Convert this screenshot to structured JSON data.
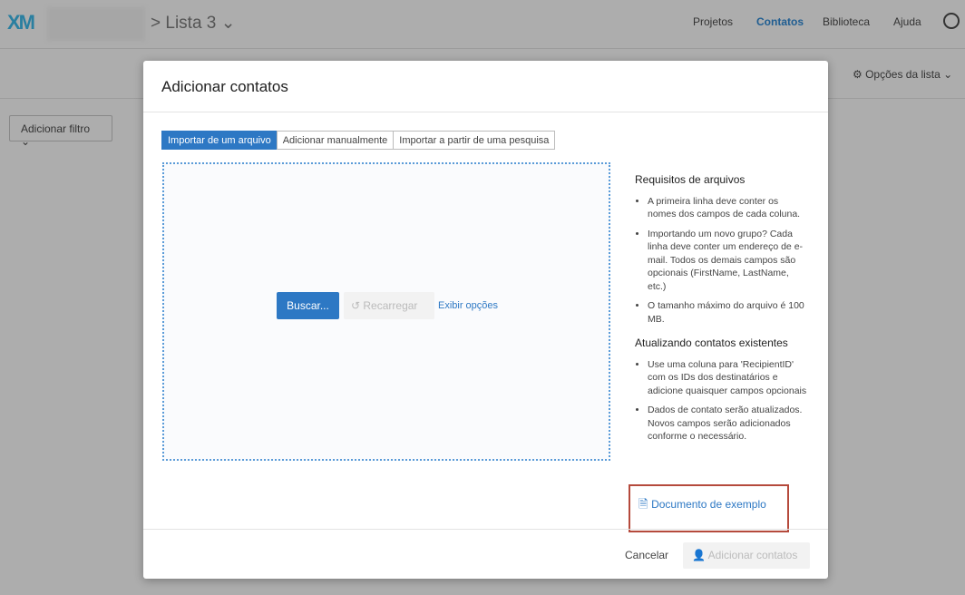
{
  "topbar": {
    "logo": "XM",
    "breadcrumb": "> Lista 3 ⌄",
    "nav": [
      "Projetos",
      "Contatos",
      "Biblioteca",
      "Ajuda"
    ]
  },
  "toolbar": {
    "list_options": "Opções da lista ⌄",
    "add_filter": "Adicionar filtro ⌄"
  },
  "modal": {
    "title": "Adicionar contatos",
    "tabs": [
      "Importar de um arquivo",
      "Adicionar manualmente",
      "Importar a partir de uma pesquisa"
    ],
    "browse": "Buscar...",
    "reload": "Recarregar",
    "show_options": "Exibir opções",
    "req_title": "Requisitos de arquivos",
    "req": [
      "A primeira linha deve conter os nomes dos campos de cada coluna.",
      "Importando um novo grupo? Cada linha deve conter um endereço de e-mail. Todos os demais campos são opcionais (FirstName, LastName, etc.)",
      "O tamanho máximo do arquivo é 100 MB."
    ],
    "upd_title": "Atualizando contatos existentes",
    "upd": [
      "Use uma coluna para 'RecipientID' com os IDs dos destinatários e adicione quaisquer campos opcionais",
      "Dados de contato serão atualizados. Novos campos serão adicionados conforme o necessário."
    ],
    "sample": "Documento de exemplo",
    "cancel": "Cancelar",
    "add": "Adicionar contatos"
  }
}
